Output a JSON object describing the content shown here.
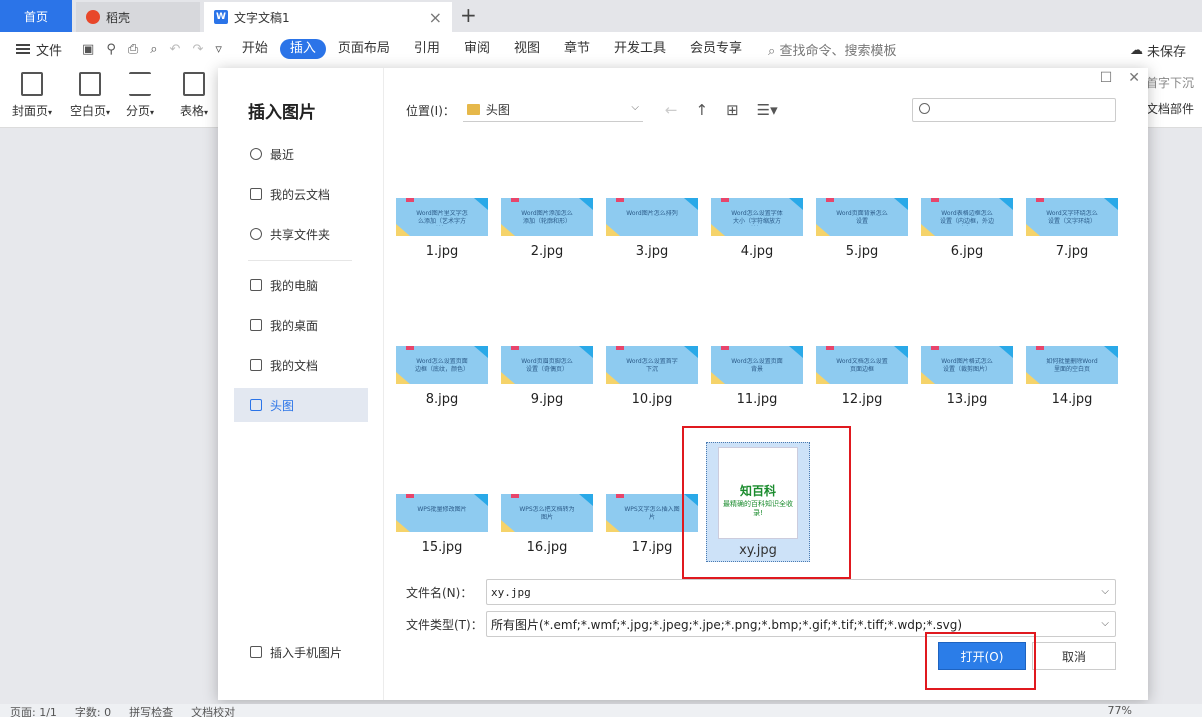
{
  "tabs": {
    "home": "首页",
    "daoke": "稻壳",
    "doc": "文字文稿1",
    "doc_close": "×",
    "add": "+"
  },
  "menubar": {
    "file": "文件",
    "items": [
      "开始",
      "插入",
      "页面布局",
      "引用",
      "审阅",
      "视图",
      "章节",
      "开发工具",
      "会员专享"
    ],
    "active": "插入",
    "search": "查找命令、搜索模板",
    "save_status": "未保存"
  },
  "ribbon": {
    "cover": "封面页",
    "blank": "空白页",
    "pagebreak": "分页",
    "table": "表格",
    "right_top": "首字下沉",
    "right_bottom": "文档部件"
  },
  "dialog": {
    "title": "插入图片",
    "sidebar": {
      "recent": "最近",
      "cloud": "我的云文档",
      "shared": "共享文件夹",
      "pc": "我的电脑",
      "desktop": "我的桌面",
      "documents": "我的文档",
      "touxiang": "头图",
      "phone": "插入手机图片"
    },
    "location_label": "位置(I)：",
    "location_value": "头图",
    "search_placeholder": "",
    "files": [
      {
        "name": "1.jpg",
        "caption": "Word图片里文字怎么添加（艺术字方法）"
      },
      {
        "name": "2.jpg",
        "caption": "Word图片添加怎么添加（轮廓和形）"
      },
      {
        "name": "3.jpg",
        "caption": "Word图片怎么排列"
      },
      {
        "name": "4.jpg",
        "caption": "Word怎么设置字体大小（字符缩放方法）"
      },
      {
        "name": "5.jpg",
        "caption": "Word页面背景怎么设置"
      },
      {
        "name": "6.jpg",
        "caption": "Word表格边框怎么设置（内边框，外边框）"
      },
      {
        "name": "7.jpg",
        "caption": "Word文字环绕怎么设置（文字环绕）"
      },
      {
        "name": "8.jpg",
        "caption": "Word怎么设置页面边框（底纹，颜色）"
      },
      {
        "name": "9.jpg",
        "caption": "Word页眉页脚怎么设置（奇偶页）"
      },
      {
        "name": "10.jpg",
        "caption": "Word怎么设置首字下沉"
      },
      {
        "name": "11.jpg",
        "caption": "Word怎么设置页面背景"
      },
      {
        "name": "12.jpg",
        "caption": "Word文档怎么设置页面边框"
      },
      {
        "name": "13.jpg",
        "caption": "Word图片格式怎么设置（裁剪图片）"
      },
      {
        "name": "14.jpg",
        "caption": "如何批量删除Word里面的空白页"
      },
      {
        "name": "15.jpg",
        "caption": "WPS批量修改图片"
      },
      {
        "name": "16.jpg",
        "caption": "WPS怎么把文档转为图片"
      },
      {
        "name": "17.jpg",
        "caption": "WPS文字怎么插入图片"
      }
    ],
    "selected_file": {
      "name": "xy.jpg",
      "title": "知百科",
      "subtitle": "最精确的百科知识全收录!"
    },
    "filename_label": "文件名(N)：",
    "filename_value": "xy.jpg",
    "filetype_label": "文件类型(T)：",
    "filetype_value": "所有图片(*.emf;*.wmf;*.jpg;*.jpeg;*.jpe;*.png;*.bmp;*.gif;*.tif;*.tiff;*.wdp;*.svg)",
    "open_button": "打开(O)",
    "cancel_button": "取消"
  },
  "statusbar": {
    "page": "页面: 1/1",
    "words": "字数: 0",
    "spell": "拼写检查",
    "proof": "文档校对",
    "zoom": "77%"
  },
  "colors": {
    "accent": "#2b74e8",
    "highlight_box": "#e0191f",
    "selected_bg": "#cde2f8"
  }
}
